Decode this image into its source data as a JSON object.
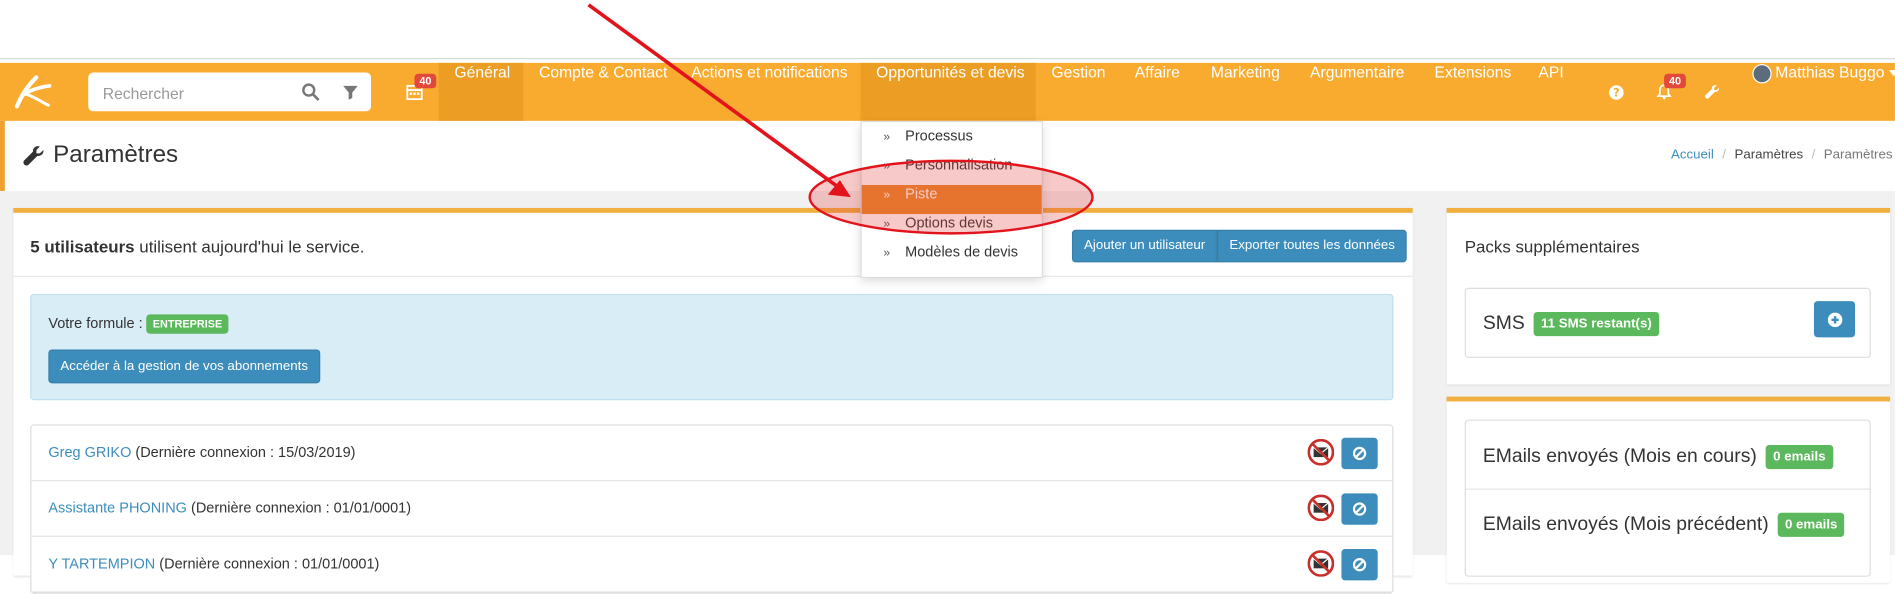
{
  "search": {
    "placeholder": "Rechercher"
  },
  "nav": {
    "calendar_badge": "40",
    "items": [
      "Général",
      "Compte & Contact",
      "Actions et notifications",
      "Opportunités et devis",
      "Gestion",
      "Affaire",
      "Marketing",
      "Argumentaire",
      "Extensions",
      "API"
    ],
    "notif_badge": "40",
    "user": "Matthias Buggo"
  },
  "dropdown": {
    "items": [
      "Processus",
      "Personnalisation",
      "Piste",
      "Options devis",
      "Modèles de devis"
    ]
  },
  "header": {
    "title": "Paramètres",
    "breadcrumb": [
      "Accueil",
      "Paramètres",
      "Paramètres"
    ]
  },
  "main": {
    "users_count": "5 utilisateurs",
    "users_text": " utilisent aujourd'hui le service.",
    "add_user": "Ajouter un utilisateur",
    "export_all": "Exporter toutes les données",
    "formula_label": "Votre formule :",
    "formula_value": "ENTREPRISE",
    "manage_subs": "Accéder à la gestion de vos abonnements",
    "users": [
      {
        "name": "Greg GRIKO",
        "info": " (Dernière connexion : 15/03/2019)"
      },
      {
        "name": "Assistante PHONING",
        "info": " (Dernière connexion : 01/01/0001)"
      },
      {
        "name": "Y TARTEMPION",
        "info": " (Dernière connexion : 01/01/0001)"
      }
    ]
  },
  "side": {
    "packs_title": "Packs supplémentaires",
    "sms_label": "SMS",
    "sms_badge": "11 SMS restant(s)",
    "emails_current": "EMails envoyés (Mois en cours)",
    "emails_current_badge": "0 emails",
    "emails_prev": "EMails envoyés (Mois précédent)",
    "emails_prev_badge": "0 emails"
  },
  "colors": {
    "navbar": "#f9ab2f",
    "accent_blue": "#3c8dbc",
    "green": "#5cb85c",
    "badge_red": "#e2493a",
    "annotation_red": "#e3131b"
  }
}
